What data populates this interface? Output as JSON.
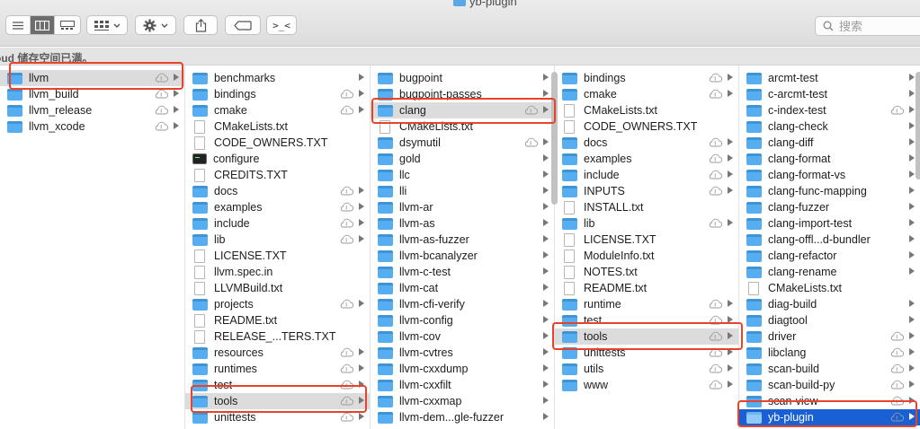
{
  "window": {
    "title": "yb-plugin"
  },
  "toolbar": {
    "view_modes": [
      "list-view-icon",
      "column-view-icon",
      "gallery-view-icon"
    ],
    "group_icon": "group-by-icon",
    "action_icon": "gear-icon",
    "share_icon": "share-icon",
    "tag_icon": "tag-icon",
    "terminal_label": ">_<"
  },
  "search": {
    "placeholder": "搜索"
  },
  "banner": {
    "text": "oud 储存空间已满。"
  },
  "colors": {
    "selection_blue": "#1860d4",
    "highlight_red": "#e8432a",
    "folder_blue": "#56aef0"
  },
  "columns": [
    {
      "items": [
        {
          "name": "llvm",
          "type": "folder",
          "cloud": true,
          "chevron": true,
          "selected": "gray"
        },
        {
          "name": "llvm_build",
          "type": "folder",
          "cloud": true,
          "chevron": true
        },
        {
          "name": "llvm_release",
          "type": "folder",
          "cloud": true,
          "chevron": true
        },
        {
          "name": "llvm_xcode",
          "type": "folder",
          "cloud": true,
          "chevron": true
        }
      ]
    },
    {
      "items": [
        {
          "name": "benchmarks",
          "type": "folder",
          "chevron": true
        },
        {
          "name": "bindings",
          "type": "folder",
          "cloud": true,
          "chevron": true
        },
        {
          "name": "cmake",
          "type": "folder",
          "cloud": true,
          "chevron": true
        },
        {
          "name": "CMakeLists.txt",
          "type": "doc"
        },
        {
          "name": "CODE_OWNERS.TXT",
          "type": "doc"
        },
        {
          "name": "configure",
          "type": "exec"
        },
        {
          "name": "CREDITS.TXT",
          "type": "doc"
        },
        {
          "name": "docs",
          "type": "folder",
          "cloud": true,
          "chevron": true
        },
        {
          "name": "examples",
          "type": "folder",
          "cloud": true,
          "chevron": true
        },
        {
          "name": "include",
          "type": "folder",
          "cloud": true,
          "chevron": true
        },
        {
          "name": "lib",
          "type": "folder",
          "cloud": true,
          "chevron": true
        },
        {
          "name": "LICENSE.TXT",
          "type": "doc"
        },
        {
          "name": "llvm.spec.in",
          "type": "doc"
        },
        {
          "name": "LLVMBuild.txt",
          "type": "doc"
        },
        {
          "name": "projects",
          "type": "folder",
          "cloud": true,
          "chevron": true
        },
        {
          "name": "README.txt",
          "type": "doc"
        },
        {
          "name": "RELEASE_...TERS.TXT",
          "type": "doc"
        },
        {
          "name": "resources",
          "type": "folder",
          "cloud": true,
          "chevron": true
        },
        {
          "name": "runtimes",
          "type": "folder",
          "cloud": true,
          "chevron": true
        },
        {
          "name": "test",
          "type": "folder",
          "cloud": true,
          "chevron": true
        },
        {
          "name": "tools",
          "type": "folder",
          "cloud": true,
          "chevron": true,
          "selected": "gray"
        },
        {
          "name": "unittests",
          "type": "folder",
          "cloud": true,
          "chevron": true
        }
      ]
    },
    {
      "items": [
        {
          "name": "bugpoint",
          "type": "folder",
          "chevron": true
        },
        {
          "name": "bugpoint-passes",
          "type": "folder",
          "chevron": true
        },
        {
          "name": "clang",
          "type": "folder",
          "cloud": true,
          "chevron": true,
          "selected": "gray"
        },
        {
          "name": "CMakeLists.txt",
          "type": "doc"
        },
        {
          "name": "dsymutil",
          "type": "folder",
          "cloud": true,
          "chevron": true
        },
        {
          "name": "gold",
          "type": "folder",
          "chevron": true
        },
        {
          "name": "llc",
          "type": "folder",
          "chevron": true
        },
        {
          "name": "lli",
          "type": "folder",
          "chevron": true
        },
        {
          "name": "llvm-ar",
          "type": "folder",
          "chevron": true
        },
        {
          "name": "llvm-as",
          "type": "folder",
          "chevron": true
        },
        {
          "name": "llvm-as-fuzzer",
          "type": "folder",
          "chevron": true
        },
        {
          "name": "llvm-bcanalyzer",
          "type": "folder",
          "chevron": true
        },
        {
          "name": "llvm-c-test",
          "type": "folder",
          "chevron": true
        },
        {
          "name": "llvm-cat",
          "type": "folder",
          "chevron": true
        },
        {
          "name": "llvm-cfi-verify",
          "type": "folder",
          "chevron": true
        },
        {
          "name": "llvm-config",
          "type": "folder",
          "chevron": true
        },
        {
          "name": "llvm-cov",
          "type": "folder",
          "chevron": true
        },
        {
          "name": "llvm-cvtres",
          "type": "folder",
          "chevron": true
        },
        {
          "name": "llvm-cxxdump",
          "type": "folder",
          "chevron": true
        },
        {
          "name": "llvm-cxxfilt",
          "type": "folder",
          "chevron": true
        },
        {
          "name": "llvm-cxxmap",
          "type": "folder",
          "chevron": true
        },
        {
          "name": "llvm-dem...gle-fuzzer",
          "type": "folder",
          "chevron": true
        }
      ]
    },
    {
      "items": [
        {
          "name": "bindings",
          "type": "folder",
          "cloud": true,
          "chevron": true
        },
        {
          "name": "cmake",
          "type": "folder",
          "cloud": true,
          "chevron": true
        },
        {
          "name": "CMakeLists.txt",
          "type": "doc"
        },
        {
          "name": "CODE_OWNERS.TXT",
          "type": "doc"
        },
        {
          "name": "docs",
          "type": "folder",
          "cloud": true,
          "chevron": true
        },
        {
          "name": "examples",
          "type": "folder",
          "cloud": true,
          "chevron": true
        },
        {
          "name": "include",
          "type": "folder",
          "cloud": true,
          "chevron": true
        },
        {
          "name": "INPUTS",
          "type": "folder",
          "cloud": true,
          "chevron": true
        },
        {
          "name": "INSTALL.txt",
          "type": "doc"
        },
        {
          "name": "lib",
          "type": "folder",
          "cloud": true,
          "chevron": true
        },
        {
          "name": "LICENSE.TXT",
          "type": "doc"
        },
        {
          "name": "ModuleInfo.txt",
          "type": "doc"
        },
        {
          "name": "NOTES.txt",
          "type": "doc"
        },
        {
          "name": "README.txt",
          "type": "doc"
        },
        {
          "name": "runtime",
          "type": "folder",
          "cloud": true,
          "chevron": true
        },
        {
          "name": "test",
          "type": "folder",
          "cloud": true,
          "chevron": true
        },
        {
          "name": "tools",
          "type": "folder",
          "cloud": true,
          "chevron": true,
          "selected": "gray"
        },
        {
          "name": "unittests",
          "type": "folder",
          "cloud": true,
          "chevron": true
        },
        {
          "name": "utils",
          "type": "folder",
          "cloud": true,
          "chevron": true
        },
        {
          "name": "www",
          "type": "folder",
          "cloud": true,
          "chevron": true
        }
      ]
    },
    {
      "items": [
        {
          "name": "arcmt-test",
          "type": "folder",
          "chevron": true
        },
        {
          "name": "c-arcmt-test",
          "type": "folder",
          "chevron": true
        },
        {
          "name": "c-index-test",
          "type": "folder",
          "cloud": true,
          "chevron": true
        },
        {
          "name": "clang-check",
          "type": "folder",
          "chevron": true
        },
        {
          "name": "clang-diff",
          "type": "folder",
          "chevron": true
        },
        {
          "name": "clang-format",
          "type": "folder",
          "chevron": true
        },
        {
          "name": "clang-format-vs",
          "type": "folder",
          "chevron": true
        },
        {
          "name": "clang-func-mapping",
          "type": "folder",
          "chevron": true
        },
        {
          "name": "clang-fuzzer",
          "type": "folder",
          "chevron": true
        },
        {
          "name": "clang-import-test",
          "type": "folder",
          "chevron": true
        },
        {
          "name": "clang-offl...d-bundler",
          "type": "folder",
          "chevron": true
        },
        {
          "name": "clang-refactor",
          "type": "folder",
          "chevron": true
        },
        {
          "name": "clang-rename",
          "type": "folder",
          "chevron": true
        },
        {
          "name": "CMakeLists.txt",
          "type": "doc"
        },
        {
          "name": "diag-build",
          "type": "folder",
          "chevron": true
        },
        {
          "name": "diagtool",
          "type": "folder",
          "chevron": true
        },
        {
          "name": "driver",
          "type": "folder",
          "cloud": true,
          "chevron": true
        },
        {
          "name": "libclang",
          "type": "folder",
          "cloud": true,
          "chevron": true
        },
        {
          "name": "scan-build",
          "type": "folder",
          "cloud": true,
          "chevron": true
        },
        {
          "name": "scan-build-py",
          "type": "folder",
          "cloud": true,
          "chevron": true
        },
        {
          "name": "scan-view",
          "type": "folder",
          "cloud": true,
          "chevron": true
        },
        {
          "name": "yb-plugin",
          "type": "folder",
          "cloud": true,
          "chevron": true,
          "selected": "blue"
        }
      ]
    }
  ]
}
